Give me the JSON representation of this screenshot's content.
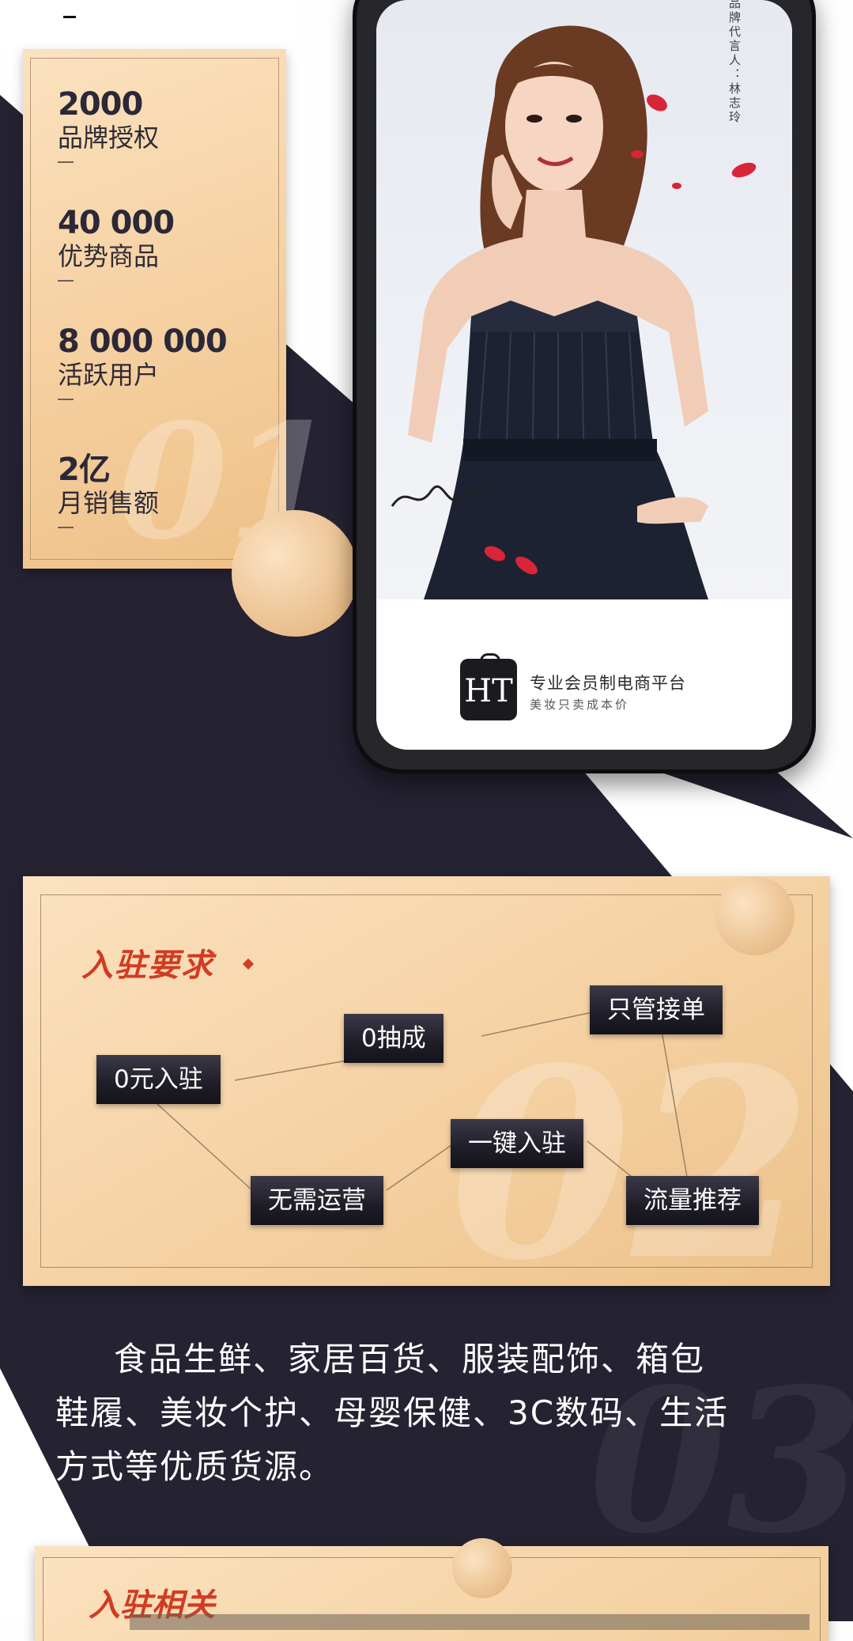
{
  "colors": {
    "dark_navy": "#252232",
    "gold": "#f4cf9f",
    "accent_red": "#d23b22",
    "white": "#ffffff"
  },
  "stats": [
    {
      "value": "2000",
      "label": "品牌授权"
    },
    {
      "value": "40 000",
      "label": "优势商品"
    },
    {
      "value": "8 000 000",
      "label": "活跃用户"
    },
    {
      "value": "2亿",
      "label": "月销售额"
    }
  ],
  "section_numbers": {
    "first": "01",
    "second": "02",
    "third": "03"
  },
  "phone": {
    "caption": "品牌代言人：林志玲",
    "logo_text": "HT",
    "tagline_main": "专业会员制电商平台",
    "tagline_sub": "美妆只卖成本价"
  },
  "requirements": {
    "title": "入驻要求",
    "tags": {
      "zero_fee_entry": "0元入驻",
      "zero_commission": "0抽成",
      "just_take_orders": "只管接单",
      "one_click_entry": "一键入驻",
      "no_operation": "无需运营",
      "traffic_recommend": "流量推荐"
    }
  },
  "categories": {
    "lines": [
      "食品生鲜、家居百货、服装配饰、箱包",
      "鞋履、美妆个护、母婴保健、3C数码、生活",
      "方式等优质货源。"
    ]
  },
  "bottom": {
    "title": "入驻相关"
  }
}
